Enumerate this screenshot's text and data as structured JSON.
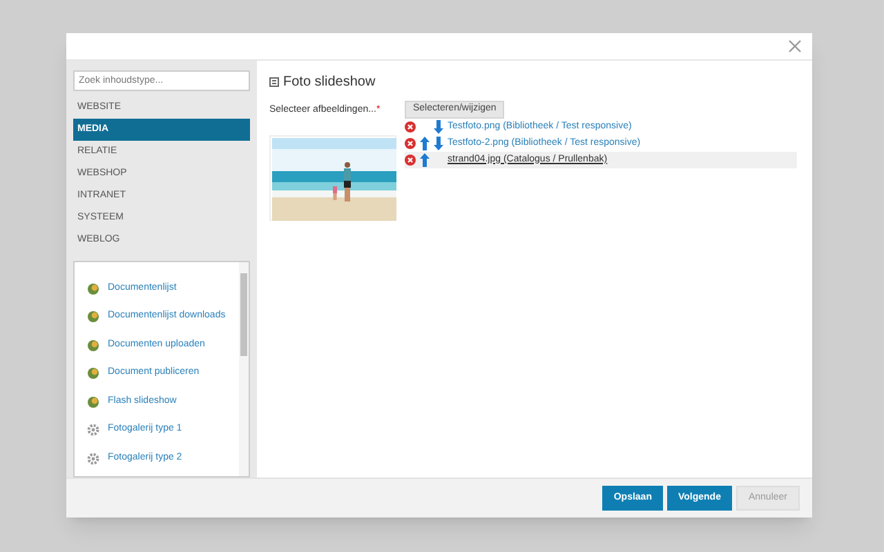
{
  "sidebar": {
    "search": {
      "placeholder": "Zoek inhoudstype..."
    },
    "categories": [
      {
        "label": "WEBSITE",
        "selected": false
      },
      {
        "label": "MEDIA",
        "selected": true
      },
      {
        "label": "RELATIE",
        "selected": false
      },
      {
        "label": "WEBSHOP",
        "selected": false
      },
      {
        "label": "INTRANET",
        "selected": false
      },
      {
        "label": "SYSTEEM",
        "selected": false
      },
      {
        "label": "WEBLOG",
        "selected": false
      }
    ],
    "items": [
      {
        "label": "Documentenlijst",
        "kind": "module"
      },
      {
        "label": "Documentenlijst downloads",
        "kind": "module"
      },
      {
        "label": "Documenten uploaden",
        "kind": "module"
      },
      {
        "label": "Document publiceren",
        "kind": "module"
      },
      {
        "label": "Flash slideshow",
        "kind": "module"
      },
      {
        "label": "Fotogalerij type 1",
        "kind": "gear"
      },
      {
        "label": "Fotogalerij type 2",
        "kind": "gear"
      }
    ]
  },
  "content": {
    "title": "Foto slideshow",
    "field_label": "Selecteer afbeeldingen...",
    "required_mark": "*",
    "select_button": "Selecteren/wijzigen",
    "files": [
      {
        "name": "Testfoto.png (Bibliotheek / Test responsive)",
        "can_move_up": false,
        "can_move_down": true,
        "selected": false
      },
      {
        "name": "Testfoto-2.png (Bibliotheek / Test responsive)",
        "can_move_up": true,
        "can_move_down": true,
        "selected": false
      },
      {
        "name": "strand04.jpg (Catalogus / Prullenbak)",
        "can_move_up": true,
        "can_move_down": false,
        "selected": true
      }
    ]
  },
  "footer": {
    "buttons": [
      {
        "label": "Opslaan",
        "kind": "primary"
      },
      {
        "label": "Volgende",
        "kind": "primary"
      },
      {
        "label": "Annuleer",
        "kind": "secondary"
      }
    ]
  }
}
